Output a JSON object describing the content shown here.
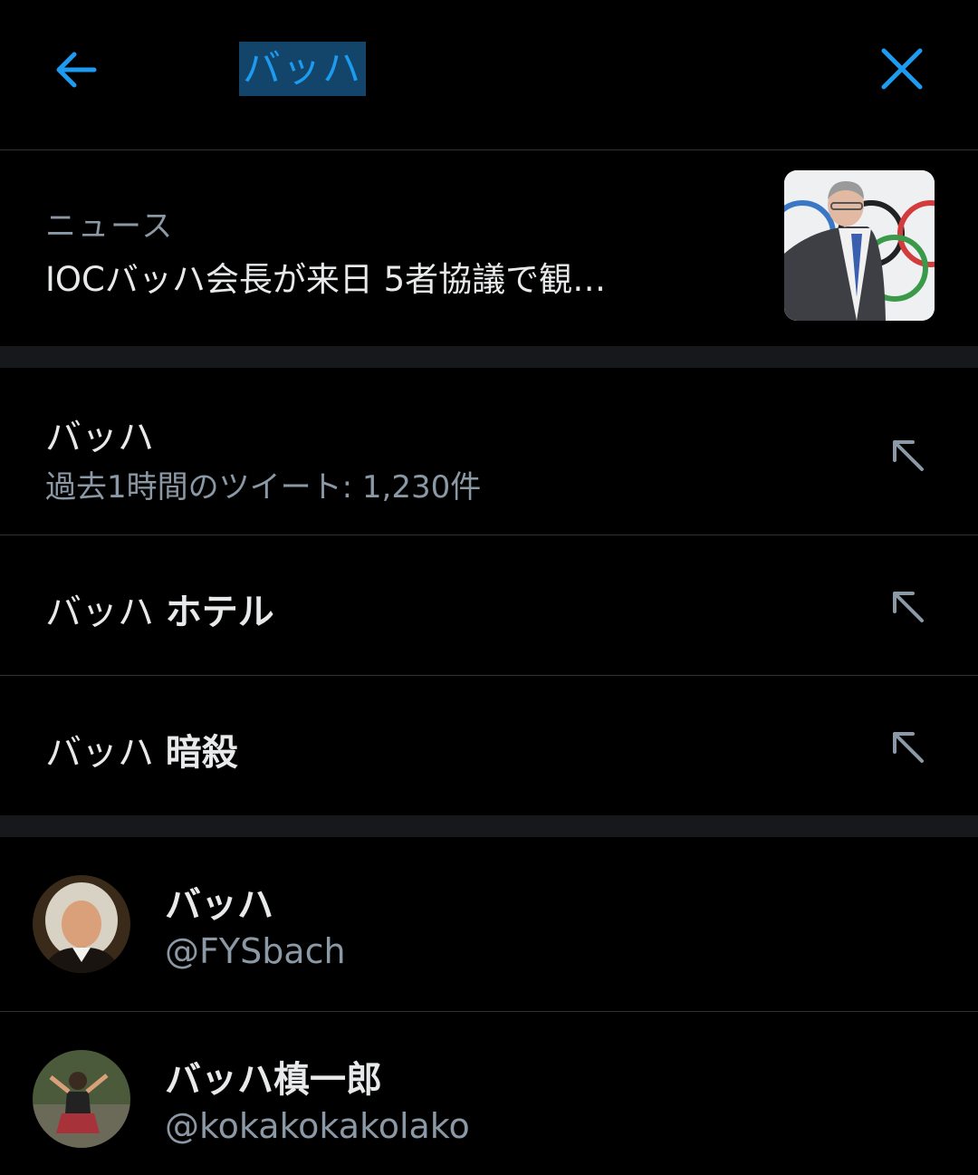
{
  "colors": {
    "accent": "#1d9bf0",
    "background": "#000000",
    "secondary_text": "#8b98a5",
    "divider": "#16181c"
  },
  "header": {
    "back_icon": "arrow-left-icon",
    "search_value": "バッハ",
    "close_icon": "close-icon"
  },
  "news": {
    "label": "ニュース",
    "title": "IOCバッハ会長が来日 5者協議で観…",
    "thumbnail": "news-photo"
  },
  "suggestions": [
    {
      "prefix": "バッハ",
      "bold": "",
      "subtitle": "過去1時間のツイート: 1,230件",
      "icon": "arrow-up-left-icon"
    },
    {
      "prefix": "バッハ ",
      "bold": "ホテル",
      "subtitle": "",
      "icon": "arrow-up-left-icon"
    },
    {
      "prefix": "バッハ ",
      "bold": "暗殺",
      "subtitle": "",
      "icon": "arrow-up-left-icon"
    }
  ],
  "users": [
    {
      "name": "バッハ",
      "handle": "@FYSbach"
    },
    {
      "name": "バッハ槙一郎",
      "handle": "@kokakokakolako"
    }
  ]
}
